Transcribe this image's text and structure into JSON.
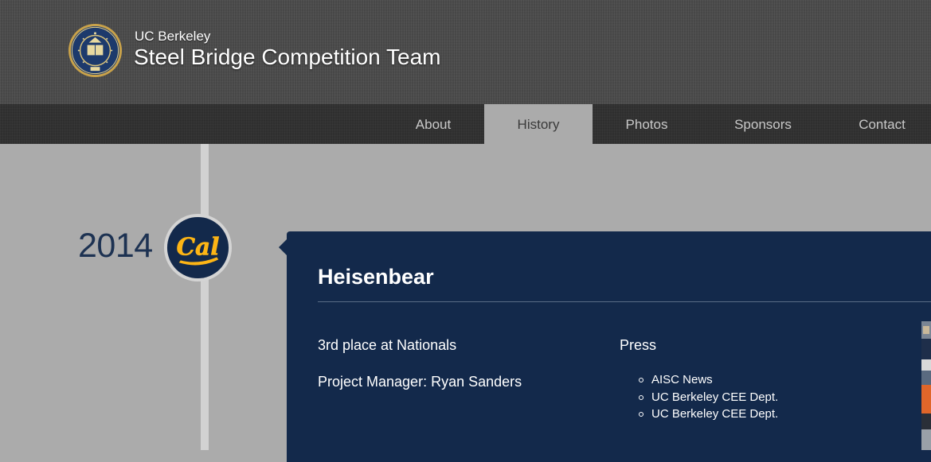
{
  "header": {
    "brand_small": "UC Berkeley",
    "brand_large": "Steel Bridge Competition Team",
    "seal_icon": "uc-seal-icon"
  },
  "nav": {
    "items": [
      {
        "label": "About",
        "active": false
      },
      {
        "label": "History",
        "active": true
      },
      {
        "label": "Photos",
        "active": false
      },
      {
        "label": "Sponsors",
        "active": false
      },
      {
        "label": "Contact",
        "active": false
      }
    ]
  },
  "timeline": {
    "year": "2014",
    "logo_text": "Cal",
    "logo_icon": "cal-logo-icon"
  },
  "entry": {
    "title": "Heisenbear",
    "lines": [
      "3rd place at Nationals",
      "Project Manager: Ryan Sanders"
    ],
    "press_heading": "Press",
    "press_links": [
      "AISC News",
      "UC Berkeley CEE Dept.",
      "UC Berkeley CEE Dept."
    ]
  },
  "colors": {
    "card_bg": "#13294b",
    "gold": "#fdb515",
    "nav_active_bg": "#ababab",
    "year_text": "#1d3252"
  }
}
